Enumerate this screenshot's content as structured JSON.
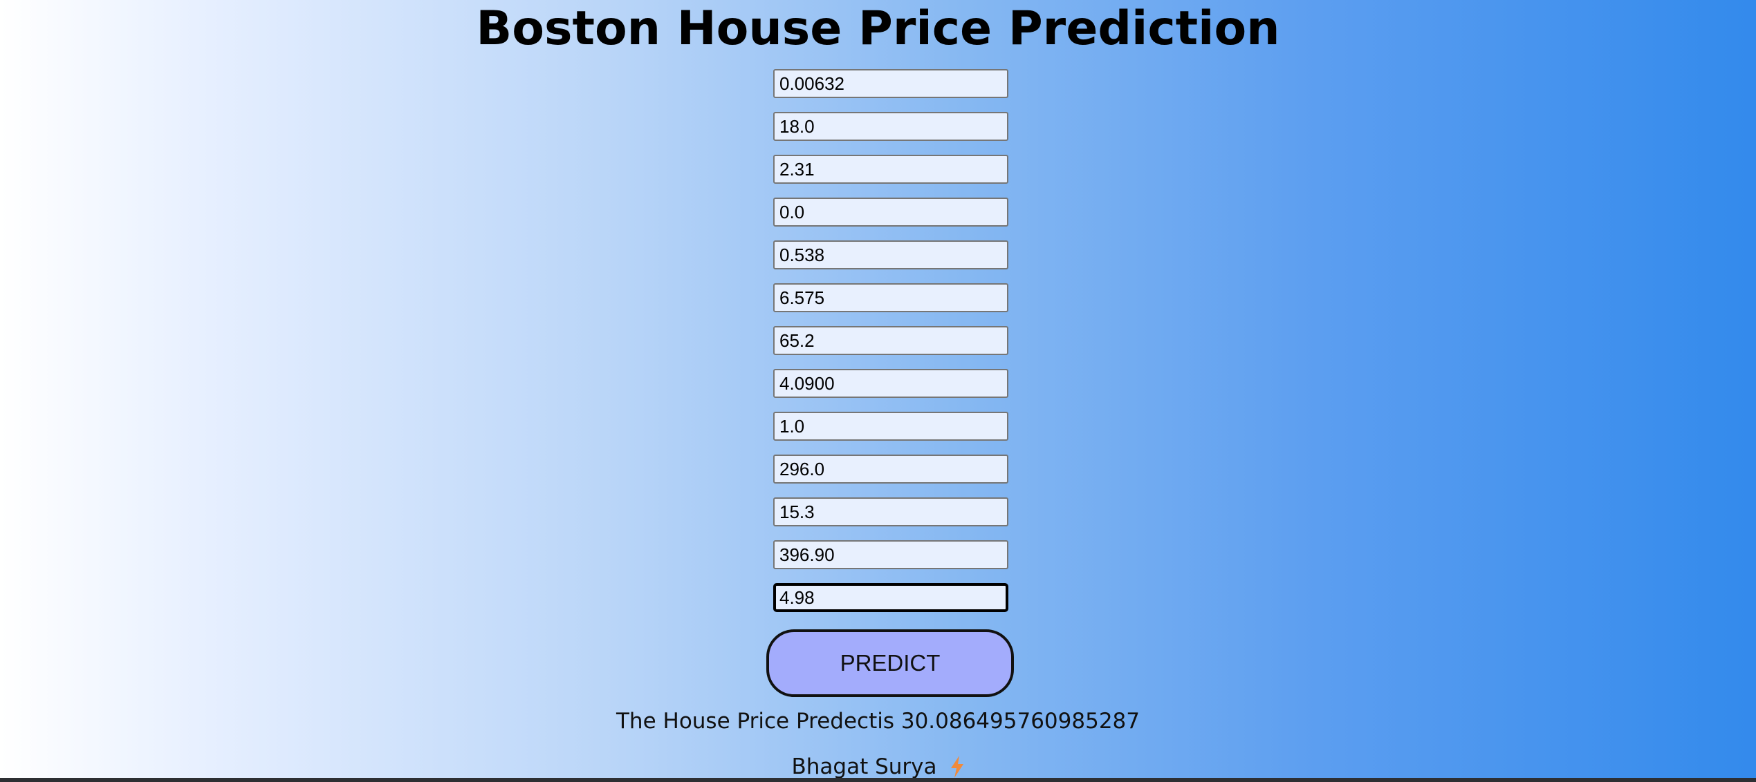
{
  "page": {
    "title": "Boston House Price Prediction"
  },
  "form": {
    "fields": [
      {
        "value": "0.00632"
      },
      {
        "value": "18.0"
      },
      {
        "value": "2.31"
      },
      {
        "value": "0.0"
      },
      {
        "value": "0.538"
      },
      {
        "value": "6.575"
      },
      {
        "value": "65.2"
      },
      {
        "value": "4.0900"
      },
      {
        "value": "1.0"
      },
      {
        "value": "296.0"
      },
      {
        "value": "15.3"
      },
      {
        "value": "396.90"
      },
      {
        "value": "4.98"
      }
    ],
    "focused_field_index": 12,
    "predict_label": "PREDICT"
  },
  "result": {
    "text": "The House Price Predectis 30.086495760985287"
  },
  "footer": {
    "author": "Bhagat Surya",
    "icon": "lightning-bolt-icon",
    "icon_color": "#f08a3c"
  },
  "colors": {
    "background_start": "#ffffff",
    "background_end": "#338aec",
    "field_background": "#e8f0fe",
    "button_background": "#a3acfc"
  }
}
